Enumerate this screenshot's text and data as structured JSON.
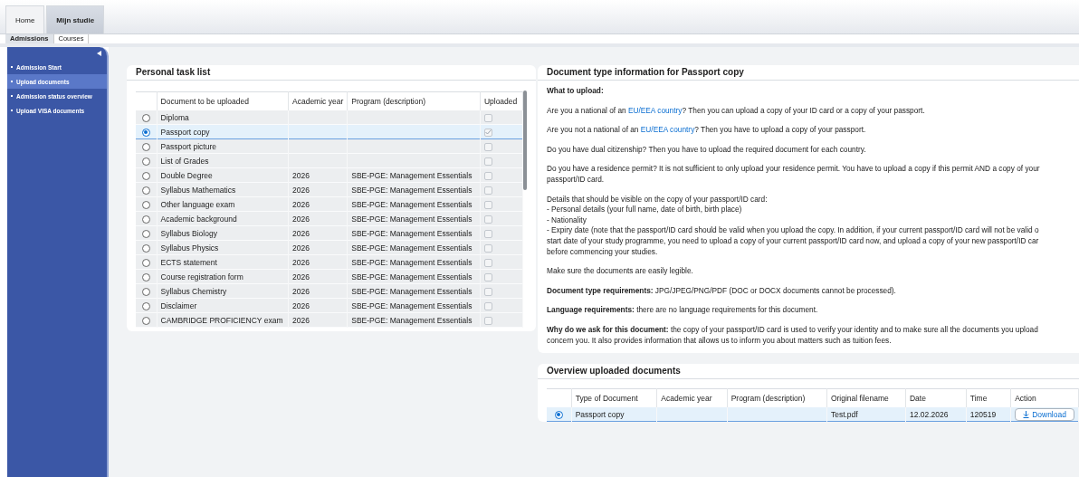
{
  "top_tabs": [
    {
      "label": "Home",
      "selected": false
    },
    {
      "label": "Mijn studie",
      "selected": true
    }
  ],
  "sub_tabs": [
    {
      "label": "Admissions",
      "selected": true
    },
    {
      "label": "Courses",
      "selected": false
    }
  ],
  "sidebar": {
    "items": [
      {
        "label": "Admission Start",
        "selected": false
      },
      {
        "label": "Upload documents",
        "selected": true
      },
      {
        "label": "Admission status overview",
        "selected": false
      },
      {
        "label": "Upload VISA documents",
        "selected": false
      }
    ]
  },
  "task_list": {
    "title": "Personal task list",
    "columns": [
      "Document to be uploaded",
      "Academic year",
      "Program (description)",
      "Uploaded"
    ],
    "rows": [
      {
        "document": "Diploma",
        "year": "",
        "program": "",
        "selected": false,
        "uploaded": false
      },
      {
        "document": "Passport copy",
        "year": "",
        "program": "",
        "selected": true,
        "uploaded": true
      },
      {
        "document": "Passport picture",
        "year": "",
        "program": "",
        "selected": false,
        "uploaded": false
      },
      {
        "document": "List of Grades",
        "year": "",
        "program": "",
        "selected": false,
        "uploaded": false
      },
      {
        "document": "Double Degree",
        "year": "2026",
        "program": "SBE-PGE: Management Essentials",
        "selected": false,
        "uploaded": false
      },
      {
        "document": "Syllabus Mathematics",
        "year": "2026",
        "program": "SBE-PGE: Management Essentials",
        "selected": false,
        "uploaded": false
      },
      {
        "document": "Other language exam",
        "year": "2026",
        "program": "SBE-PGE: Management Essentials",
        "selected": false,
        "uploaded": false
      },
      {
        "document": "Academic background",
        "year": "2026",
        "program": "SBE-PGE: Management Essentials",
        "selected": false,
        "uploaded": false
      },
      {
        "document": "Syllabus Biology",
        "year": "2026",
        "program": "SBE-PGE: Management Essentials",
        "selected": false,
        "uploaded": false
      },
      {
        "document": "Syllabus Physics",
        "year": "2026",
        "program": "SBE-PGE: Management Essentials",
        "selected": false,
        "uploaded": false
      },
      {
        "document": "ECTS statement",
        "year": "2026",
        "program": "SBE-PGE: Management Essentials",
        "selected": false,
        "uploaded": false
      },
      {
        "document": "Course registration form",
        "year": "2026",
        "program": "SBE-PGE: Management Essentials",
        "selected": false,
        "uploaded": false
      },
      {
        "document": "Syllabus Chemistry",
        "year": "2026",
        "program": "SBE-PGE: Management Essentials",
        "selected": false,
        "uploaded": false
      },
      {
        "document": "Disclaimer",
        "year": "2026",
        "program": "SBE-PGE: Management Essentials",
        "selected": false,
        "uploaded": false
      },
      {
        "document": "CAMBRIDGE PROFICIENCY exam",
        "year": "2026",
        "program": "SBE-PGE: Management Essentials",
        "selected": false,
        "uploaded": false
      }
    ]
  },
  "info": {
    "title": "Document type information for Passport copy",
    "paragraphs": [
      {
        "parts": [
          {
            "text": "**What to upload:**"
          }
        ]
      },
      {
        "parts": [
          {
            "text": "Are you a national of an "
          },
          {
            "text": "EU/EEA country",
            "link": true
          },
          {
            "text": "? Then you can upload a copy of your ID card or a copy of your passport."
          }
        ]
      },
      {
        "parts": [
          {
            "text": "Are you not a national of an "
          },
          {
            "text": "EU/EEA country",
            "link": true
          },
          {
            "text": "? Then you have to upload a copy of your passport."
          }
        ]
      },
      {
        "parts": [
          {
            "text": "Do you have dual citizenship? Then you have to upload the required document for each country."
          }
        ]
      },
      {
        "parts": [
          {
            "text": "Do you have a residence permit? It is not sufficient to only upload your residence permit. You have to upload a copy if this permit AND a copy of your\npassport/ID card."
          }
        ]
      },
      {
        "parts": [
          {
            "text": "Details that should be visible on the copy of your passport/ID card:\n- Personal details (your full name, date of birth, birth place)\n- Nationality\n- Expiry date (note that the passport/ID card should be valid when you upload the copy. In addition, if your current passport/ID card will not be valid o\nstart date of your study programme, you need to upload a copy of your current passport/ID card now, and upload a copy of your new passport/ID car\nbefore commencing your studies."
          }
        ]
      },
      {
        "parts": [
          {
            "text": "Make sure the documents are easily legible."
          }
        ]
      },
      {
        "parts": [
          {
            "text": "**Document type requirements:** JPG/JPEG/PNG/PDF (DOC or DOCX documents cannot be processed)."
          }
        ]
      },
      {
        "parts": [
          {
            "text": "**Language requirements:** there are no language requirements for this document."
          }
        ]
      },
      {
        "parts": [
          {
            "text": "**Why do we ask for this document:** the copy of your passport/ID card is used to verify your identity and to make sure all the documents you upload\nconcern you. It also provides information that allows us to inform you about matters such as tuition fees."
          }
        ]
      }
    ]
  },
  "uploaded": {
    "title": "Overview uploaded documents",
    "columns": [
      "Type of Document",
      "Academic year",
      "Program (description)",
      "Original filename",
      "Date",
      "Time",
      "Action"
    ],
    "rows": [
      {
        "selected": true,
        "type": "Passport copy",
        "year": "",
        "program": "",
        "filename": "Test.pdf",
        "date": "12.02.2026",
        "time": "120519",
        "action": "Download"
      }
    ]
  }
}
